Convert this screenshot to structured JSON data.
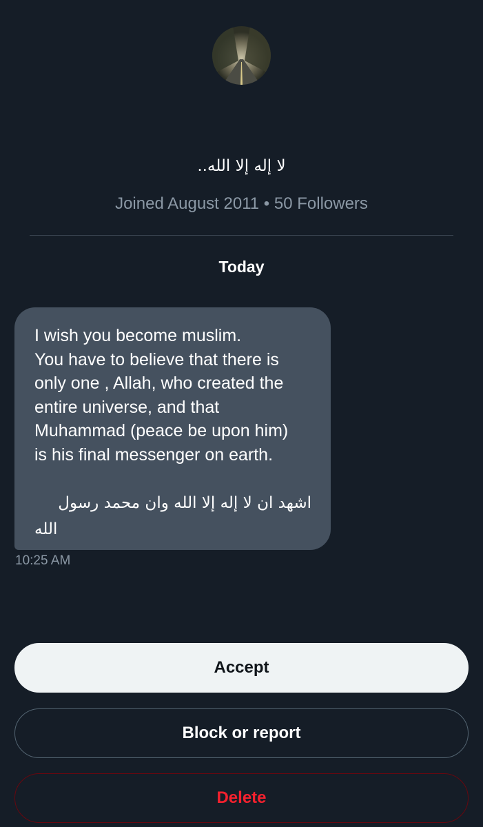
{
  "profile": {
    "display_name": "لا إله إلا الله..",
    "meta": "Joined August 2011 • 50 Followers"
  },
  "conversation": {
    "date_separator": "Today",
    "message": {
      "lines": [
        "I wish you become muslim.",
        "You have to believe that there is",
        "only one , Allah, who created the",
        "entire universe, and that",
        "Muhammad (peace be upon him)",
        "is his final messenger on earth."
      ],
      "arabic_lines": [
        "اشهد ان لا إله إلا الله وان محمد رسول",
        "الله"
      ],
      "timestamp": "10:25 AM"
    }
  },
  "actions": {
    "accept_label": "Accept",
    "block_label": "Block or report",
    "delete_label": "Delete"
  },
  "colors": {
    "background": "#151d27",
    "bubble": "#45515f",
    "accept_bg": "#eff3f4",
    "delete_text": "#f4212e",
    "muted_text": "#8b98a5"
  },
  "icons": {
    "top_right": "info-circle-icon",
    "avatar": "forest-road-avatar"
  }
}
